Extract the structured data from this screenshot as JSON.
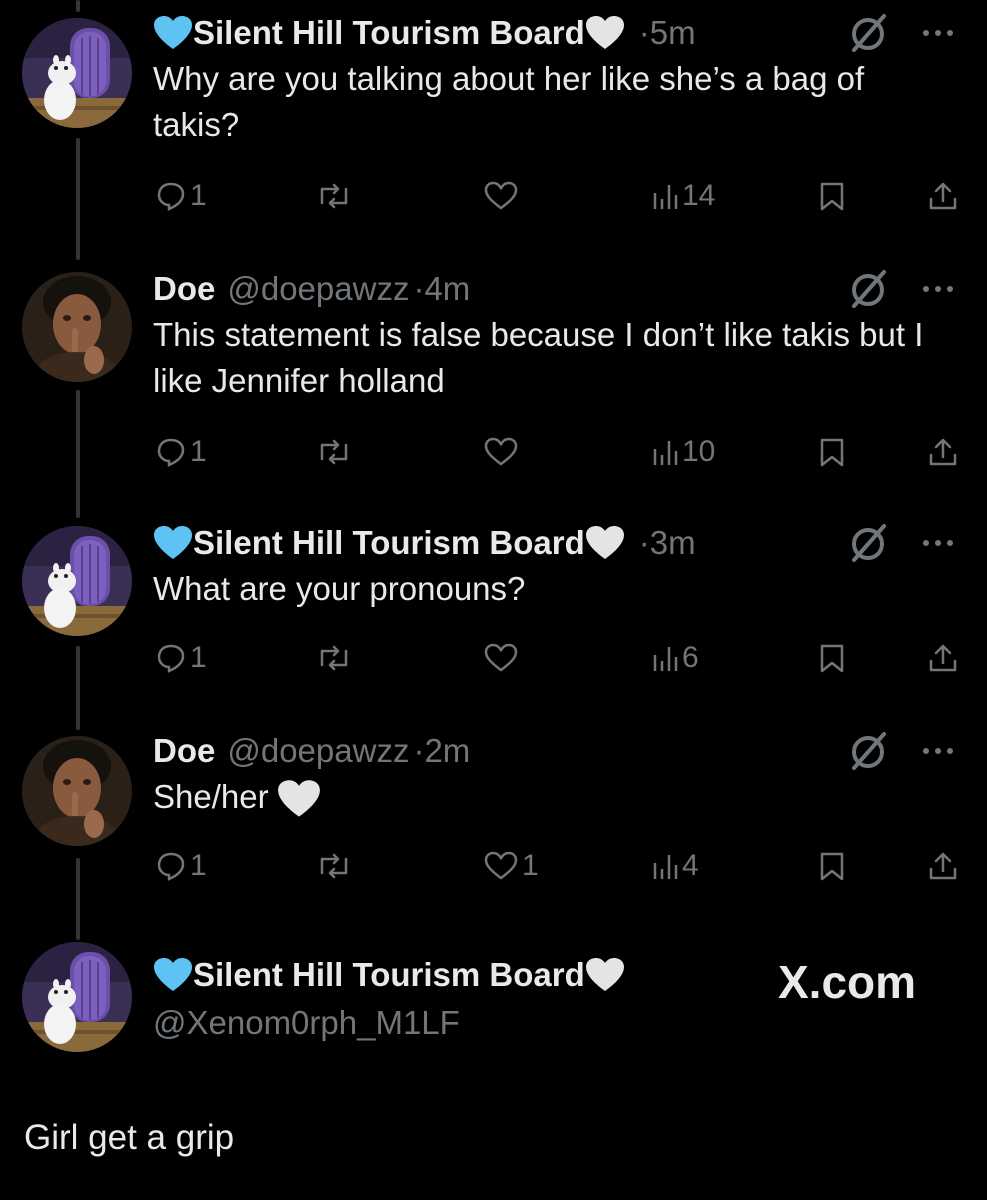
{
  "tweets": [
    {
      "name": "Silent Hill Tourism Board",
      "handle": "",
      "time": "5m",
      "text": "Why are you talking about her like she’s a bag of takis?",
      "replies": "1",
      "reposts": "",
      "likes": "",
      "views": "14",
      "avatar": "moomin-avatar",
      "emoji_name": true
    },
    {
      "name": "Doe",
      "handle": "@doepawzz",
      "time": "4m",
      "text": "This statement is false because I don’t like takis but I like Jennifer holland",
      "replies": "1",
      "reposts": "",
      "likes": "",
      "views": "10",
      "avatar": "person-avatar",
      "emoji_name": false
    },
    {
      "name": "Silent Hill Tourism Board",
      "handle": "",
      "time": "3m",
      "text": "What are your pronouns?",
      "replies": "1",
      "reposts": "",
      "likes": "",
      "views": "6",
      "avatar": "moomin-avatar",
      "emoji_name": true
    },
    {
      "name": "Doe",
      "handle": "@doepawzz",
      "time": "2m",
      "text": "She/her",
      "replies": "1",
      "reposts": "",
      "likes": "1",
      "views": "4",
      "avatar": "person-avatar",
      "emoji_name": false
    }
  ],
  "final": {
    "name": "Silent Hill Tourism Board",
    "handle": "@Xenom0rph_M1LF",
    "text": "Girl get a grip"
  },
  "watermark": "X.com",
  "separator": "·",
  "colors": {
    "background": "#000000",
    "text": "#e7e9ea",
    "muted": "#71767b",
    "blue_heart": "#5ec3f2",
    "white_heart": "#e9e9e9"
  }
}
